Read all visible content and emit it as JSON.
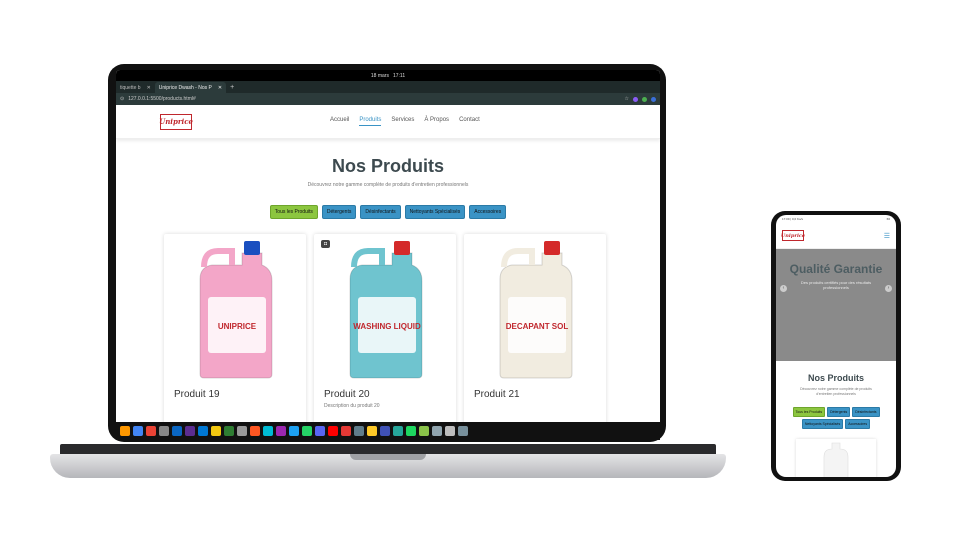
{
  "os": {
    "date": "18 mars",
    "time": "17:11"
  },
  "browser": {
    "tabs": [
      {
        "label": "tiquette b",
        "active": false
      },
      {
        "label": "Uniprice Dwash - Nos P",
        "active": true
      }
    ],
    "url": "127.0.0.1:5500/products.html#"
  },
  "site": {
    "logo": "Uniprice",
    "nav": [
      "Accueil",
      "Produits",
      "Services",
      "À Propos",
      "Contact"
    ],
    "title": "Nos Produits",
    "subtitle": "Découvrez notre gamme complète de produits d'entretien professionnels",
    "filters": [
      "Tous les Produits",
      "Détergents",
      "Désinfectants",
      "Nettoyants Spécialisés",
      "Accessoires"
    ],
    "products": [
      {
        "name": "Produit 19",
        "desc": "",
        "color": "#f3a6c8",
        "cap": "#1a4fc0",
        "label": "UNIPRICE"
      },
      {
        "name": "Produit 20",
        "desc": "Description du produit 20",
        "color": "#6fc4cf",
        "cap": "#d42a2a",
        "label": "WASHING LIQUID"
      },
      {
        "name": "Produit 21",
        "desc": "",
        "color": "#f1ece0",
        "cap": "#d42a2a",
        "label": "DECAPANT SOL"
      }
    ]
  },
  "phone": {
    "status": "17:09 | 0,0 Ko/s",
    "battery": "66",
    "hero_title": "Qualité Garantie",
    "hero_sub": "Des produits certifiés pour des résultats professionnels",
    "title": "Nos Produits",
    "subtitle": "Découvrez notre gamme complète de produits d'entretien professionnels",
    "filters": [
      "Tous les Produits",
      "Détergents",
      "Désinfectants",
      "Nettoyants Spécialisés",
      "Accessoires"
    ]
  },
  "colors": {
    "accent_blue": "#3a93c5",
    "accent_green": "#8cc63f",
    "brand_red": "#c0272d"
  }
}
